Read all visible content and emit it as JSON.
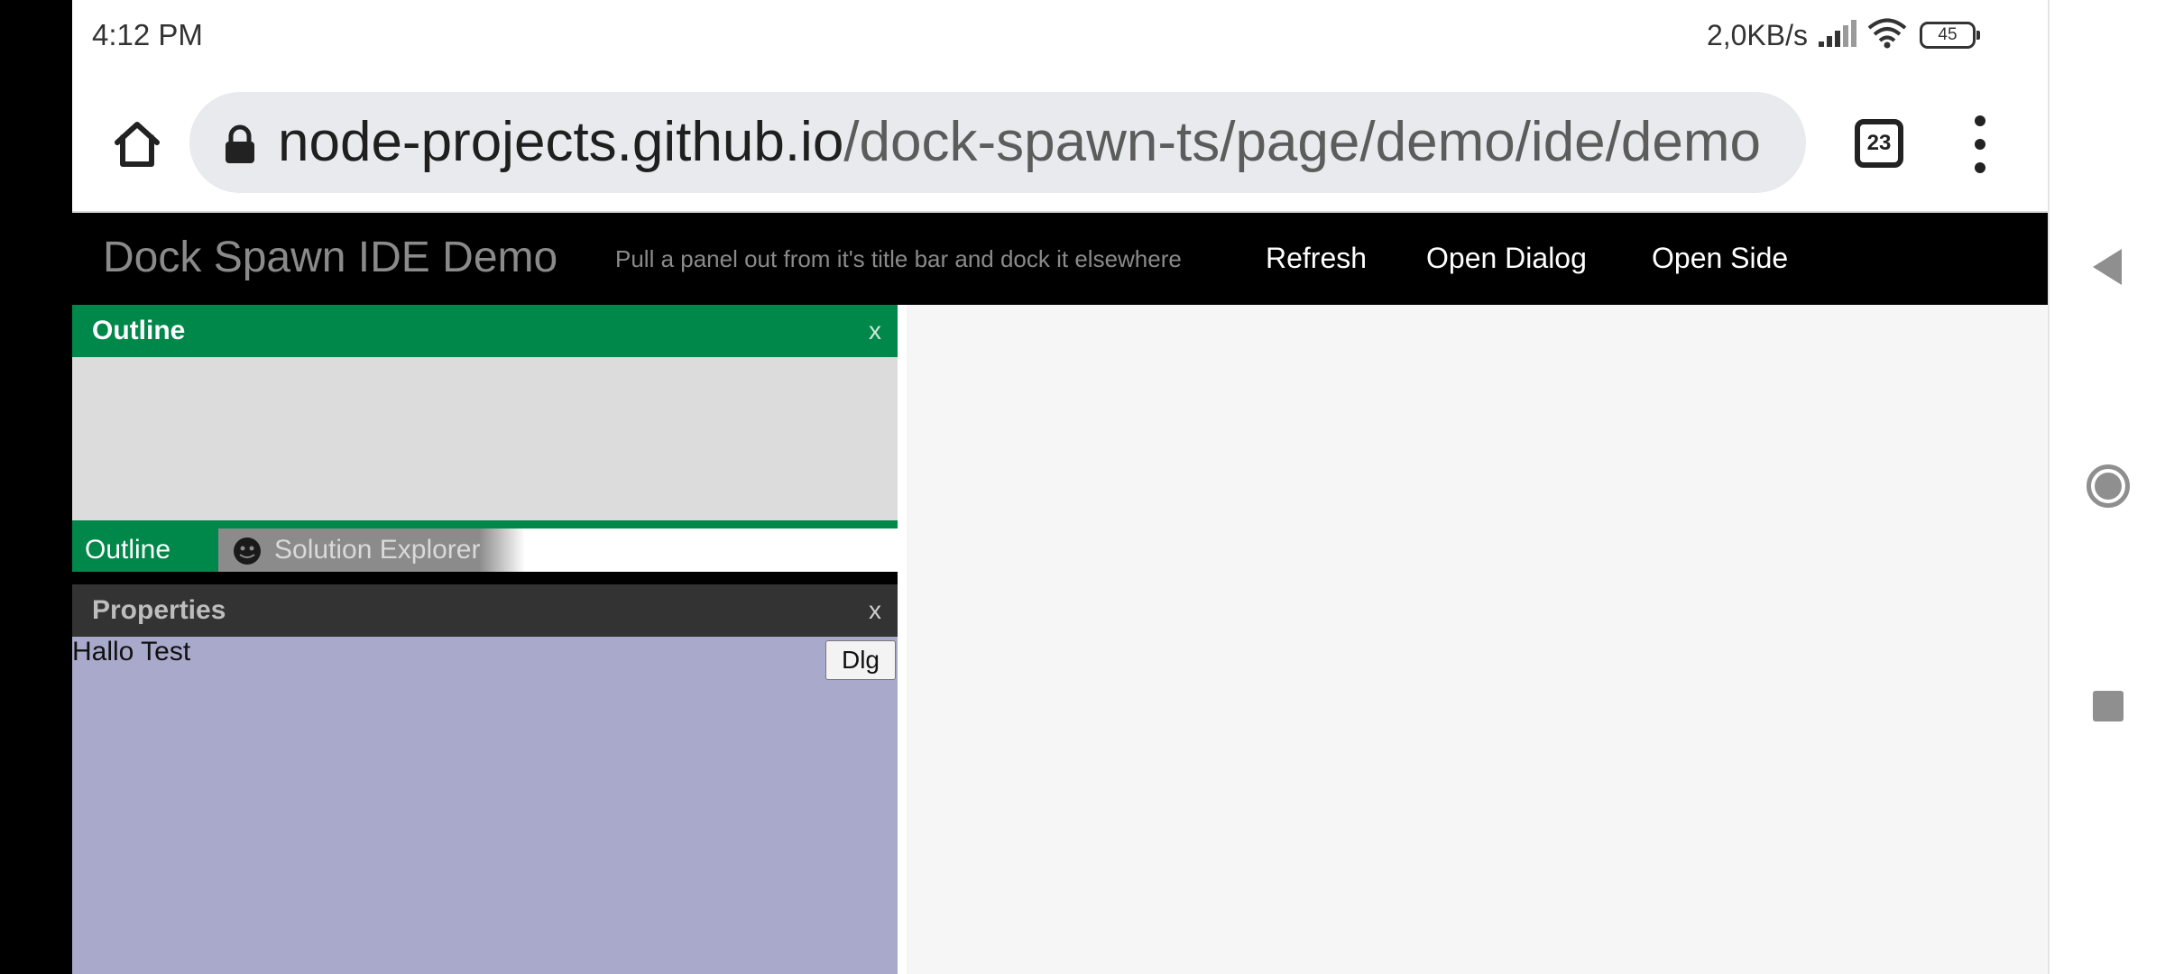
{
  "status_bar": {
    "time": "4:12 PM",
    "network_speed": "2,0KB/s",
    "battery": "45"
  },
  "browser": {
    "url_host": "node-projects.github.io",
    "url_path": "/dock-spawn-ts/page/demo/ide/demo",
    "tab_count": "23"
  },
  "app": {
    "title": "Dock Spawn IDE Demo",
    "subtitle": "Pull a panel out from it's title bar and dock it elsewhere",
    "nav": {
      "refresh": "Refresh",
      "open_dialog": "Open Dialog",
      "open_side": "Open Side"
    }
  },
  "panels": {
    "outline": {
      "title": "Outline",
      "close": "x"
    },
    "tabs": [
      {
        "label": "Outline",
        "active": true
      },
      {
        "label": "Solution Explorer",
        "active": false,
        "icon": "github-icon"
      }
    ],
    "properties": {
      "title": "Properties",
      "close": "x",
      "body_text": "Hallo Test",
      "button_label": "Dlg"
    }
  },
  "colors": {
    "accent_green": "#00874a",
    "properties_bg": "#a9a9cc",
    "header_bg": "#000000",
    "panel_header_dark": "#333333"
  }
}
